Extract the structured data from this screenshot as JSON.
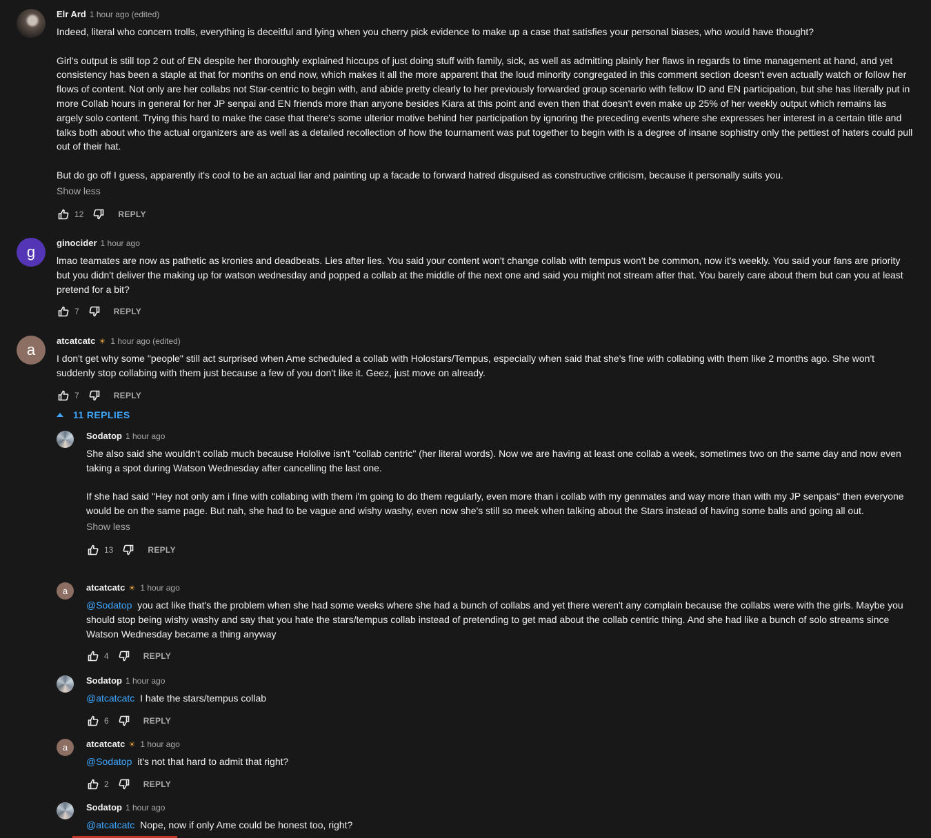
{
  "comments": [
    {
      "author": "Elr Ard",
      "time": "1 hour ago (edited)",
      "text": "Indeed, literal who concern trolls, everything is deceitful and lying when you cherry pick evidence to make up a case that satisfies your personal biases, who would have thought?\n\nGirl's output is still top 2 out of EN despite her thoroughly explained hiccups of just doing stuff with family, sick, as well as admitting plainly her flaws in regards to time management at hand, and yet consistency has been a staple at that for months on end now, which makes it all the more apparent that the loud minority congregated in this comment section doesn't even actually watch or follow her flows of content. Not only are her collabs not Star-centric to begin with, and abide pretty clearly to her previously forwarded group scenario with fellow ID and EN participation, but she has literally put in more Collab hours in general for her JP senpai and EN friends more than anyone besides Kiara at this point and even then that doesn't even make up 25% of her weekly output which remains las argely solo content. Trying this hard to make the case that there's some ulterior motive behind her participation by ignoring the preceding events where she expresses her interest in a certain title and talks both about who the actual organizers are as well as a detailed recollection of how the tournament was put together to begin with is a degree of insane sophistry only the pettiest of haters could pull out of their hat.\n\nBut do go off I guess, apparently it's cool to be an actual liar and painting up a facade to forward hatred disguised as constructive criticism, because it personally suits you.",
      "show_less": "Show less",
      "likes": "12",
      "reply_label": "REPLY"
    },
    {
      "author": "ginocider",
      "avatar_letter": "g",
      "time": "1 hour ago",
      "text": "lmao teamates are now as pathetic as kronies and deadbeats. Lies after lies. You said your content won't change collab with tempus won't be common, now it's weekly. You said your fans are priority but you didn't deliver the making up for watson wednesday and popped a collab at the middle of the next one and said you might not stream after that. You barely care about them but can you at least pretend for a bit?",
      "likes": "7",
      "reply_label": "REPLY"
    },
    {
      "author": "atcatcatc",
      "avatar_letter": "a",
      "time": "1 hour ago (edited)",
      "text": "I don't get why some \"people\" still act surprised when Ame scheduled a collab with Holostars/Tempus, especially when said that she's fine with collabing with them like 2 months ago. She won't suddenly stop collabing with them just because a few of you don't like it. Geez, just move on already.",
      "likes": "7",
      "reply_label": "REPLY",
      "replies_toggle": "11 REPLIES"
    }
  ],
  "replies": [
    {
      "author": "Sodatop",
      "time": "1 hour ago",
      "text": "She also said she wouldn't collab much because Hololive isn't \"collab centric\" (her literal words). Now we are having at least one collab a week, sometimes two on the same day and now even taking a spot during Watson Wednesday after cancelling the last one.\n\nIf she had said \"Hey not only am i fine with collabing with them i'm going to do them regularly, even more than i collab with my genmates and way more than with my JP senpais\" then everyone would be on the same page. But nah, she had to be vague and wishy washy, even now she's still so meek when talking about the Stars instead of having some balls and going all out.",
      "show_less": "Show less",
      "likes": "13",
      "reply_label": "REPLY"
    },
    {
      "author": "atcatcatc",
      "avatar_letter": "a",
      "time": "1 hour ago",
      "mention": "@Sodatop",
      "text": "you act like that's the problem when she had some weeks where she had a bunch of collabs and yet there weren't any complain because the collabs were with the girls. Maybe you should stop being wishy washy and say that you hate the stars/tempus collab instead of pretending to get mad about the collab centric thing. And she had like a bunch of solo streams since Watson Wednesday became a thing anyway",
      "likes": "4",
      "reply_label": "REPLY"
    },
    {
      "author": "Sodatop",
      "time": "1 hour ago",
      "mention": "@atcatcatc",
      "text": "I hate the stars/tempus collab",
      "likes": "6",
      "reply_label": "REPLY"
    },
    {
      "author": "atcatcatc",
      "avatar_letter": "a",
      "time": "1 hour ago",
      "mention": "@Sodatop",
      "text": "it's not that hard to admit that right?",
      "likes": "2",
      "reply_label": "REPLY"
    },
    {
      "author": "Sodatop",
      "time": "1 hour ago",
      "mention": "@atcatcatc",
      "text": "Nope, now if only Ame could be honest too, right?"
    }
  ],
  "colors": {
    "background": "#181818",
    "text": "#f1f1f1",
    "muted": "#aaaaaa",
    "link": "#3ea6ff"
  }
}
